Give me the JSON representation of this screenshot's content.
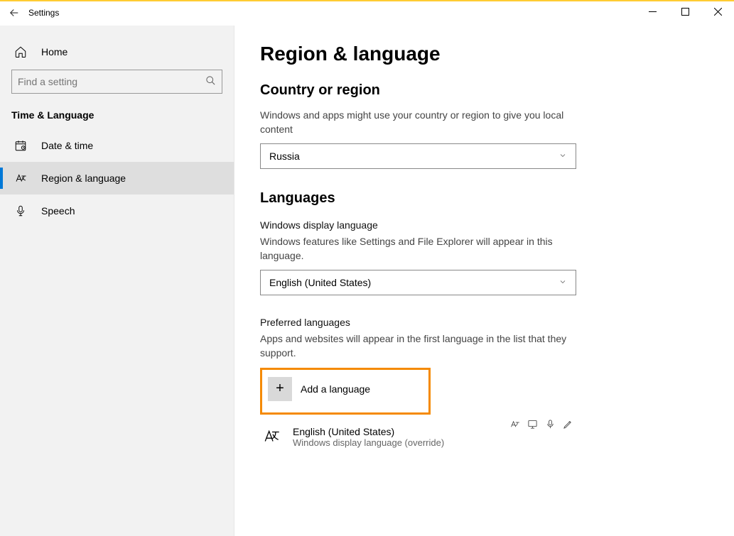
{
  "titlebar": {
    "title": "Settings"
  },
  "sidebar": {
    "home_label": "Home",
    "search_placeholder": "Find a setting",
    "category": "Time & Language",
    "items": [
      {
        "label": "Date & time"
      },
      {
        "label": "Region & language"
      },
      {
        "label": "Speech"
      }
    ]
  },
  "main": {
    "page_title": "Region & language",
    "section_country_title": "Country or region",
    "section_country_desc": "Windows and apps might use your country or region to give you local content",
    "country_value": "Russia",
    "section_lang_title": "Languages",
    "display_lang_heading": "Windows display language",
    "display_lang_desc": "Windows features like Settings and File Explorer will appear in this language.",
    "display_lang_value": "English (United States)",
    "preferred_heading": "Preferred languages",
    "preferred_desc": "Apps and websites will appear in the first language in the list that they support.",
    "add_language_label": "Add a language",
    "lang_item_name": "English (United States)",
    "lang_item_sub": "Windows display language (override)"
  }
}
